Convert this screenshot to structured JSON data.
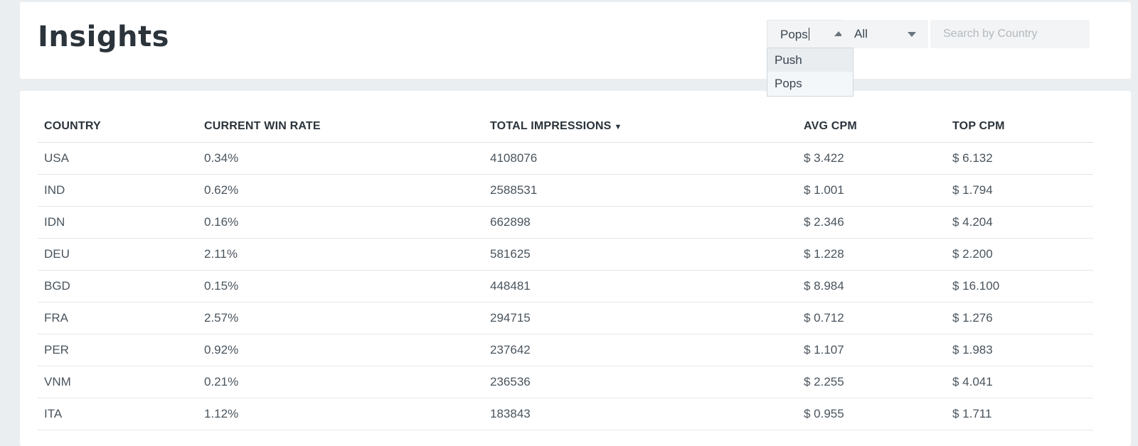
{
  "header": {
    "title": "Insights",
    "type_select": {
      "value": "Pops",
      "options": [
        "Push",
        "Pops"
      ],
      "open": true
    },
    "filter_select": {
      "value": "All"
    },
    "search": {
      "placeholder": "Search by Country",
      "value": ""
    }
  },
  "table": {
    "columns": [
      "COUNTRY",
      "CURRENT WIN RATE",
      "TOTAL IMPRESSIONS",
      "AVG CPM",
      "TOP CPM"
    ],
    "sort_indicator": "▼",
    "rows": [
      [
        "USA",
        "0.34%",
        "4108076",
        "$ 3.422",
        "$ 6.132"
      ],
      [
        "IND",
        "0.62%",
        "2588531",
        "$ 1.001",
        "$ 1.794"
      ],
      [
        "IDN",
        "0.16%",
        "662898",
        "$ 2.346",
        "$ 4.204"
      ],
      [
        "DEU",
        "2.11%",
        "581625",
        "$ 1.228",
        "$ 2.200"
      ],
      [
        "BGD",
        "0.15%",
        "448481",
        "$ 8.984",
        "$ 16.100"
      ],
      [
        "FRA",
        "2.57%",
        "294715",
        "$ 0.712",
        "$ 1.276"
      ],
      [
        "PER",
        "0.92%",
        "237642",
        "$ 1.107",
        "$ 1.983"
      ],
      [
        "VNM",
        "0.21%",
        "236536",
        "$ 2.255",
        "$ 4.041"
      ],
      [
        "ITA",
        "1.12%",
        "183843",
        "$ 0.955",
        "$ 1.711"
      ]
    ]
  },
  "icons": {
    "type_caret": "caret-up-icon",
    "filter_caret": "caret-down-icon",
    "sort": "sort-desc-icon"
  },
  "colors": {
    "background": "#ebeef0",
    "card": "#ffffff",
    "title": "#2b333b",
    "text": "#4a545d",
    "input_bg": "#f2f4f5"
  }
}
